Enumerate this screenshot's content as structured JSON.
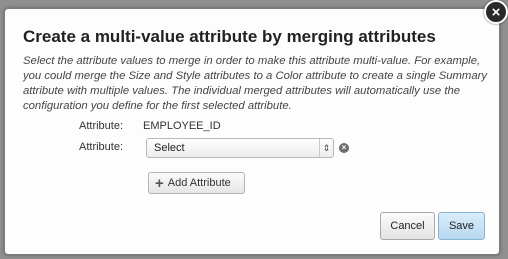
{
  "dialog": {
    "title": "Create a multi-value attribute by merging attributes",
    "description": "Select the attribute values to merge in order to make this attribute multi-value. For example, you could merge the Size and Style attributes to a Color attribute to create a single Summary attribute with multiple values. The individual merged attributes will automatically use the configuration you define for the first selected attribute.",
    "close_icon": "close-icon",
    "close_glyph": "×"
  },
  "attributes": {
    "first": {
      "label": "Attribute:",
      "value": "EMPLOYEE_ID"
    },
    "second": {
      "label": "Attribute:",
      "selected": "Select",
      "arrow_glyph": "⇕",
      "remove_glyph": "×"
    }
  },
  "buttons": {
    "add_attribute": "Add Attribute",
    "add_glyph": "+",
    "cancel": "Cancel",
    "save": "Save"
  },
  "colors": {
    "save_accent": "#b8d8f0",
    "dialog_background": "#fdfdfd",
    "backdrop": "#8f8f8f"
  }
}
